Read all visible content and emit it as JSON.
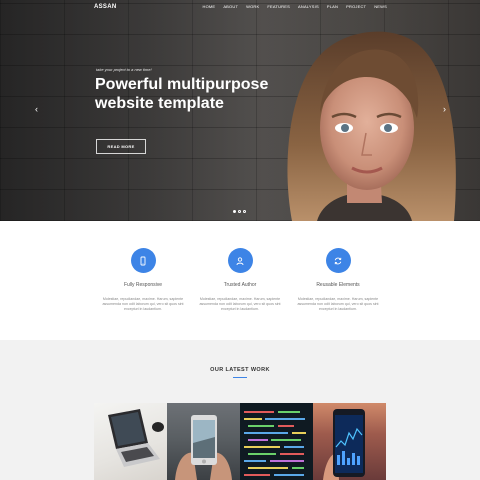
{
  "nav": {
    "logo": "ASSAN",
    "items": [
      "HOME",
      "ABOUT",
      "WORK",
      "FEATURES",
      "ANALYSIS",
      "PLAN",
      "PROJECT",
      "NEWS"
    ]
  },
  "hero": {
    "kicker": "take your project to a new time!",
    "headline": "Powerful multipurpose website template",
    "button": "READ MORE",
    "prev_icon": "chevron-left-icon",
    "next_icon": "chevron-right-icon",
    "slides": 3,
    "active_slide": 1
  },
  "features": [
    {
      "icon": "mobile-phone-icon",
      "title": "Fully Responsive",
      "text": "Molestiae, repudiandae, maxime. Harum, sapiente assumenda non odit laborum qui, vero sit quos sint excepturi in laudantium."
    },
    {
      "icon": "user-icon",
      "title": "Trusted Author",
      "text": "Molestiae, repudiandae, maxime. Harum, sapiente assumenda non odit laborum qui, vero sit quos sint excepturi in laudantium."
    },
    {
      "icon": "refresh-icon",
      "title": "Reusable Elements",
      "text": "Molestiae, repudiandae, maxime. Harum, sapiente assumenda non odit laborum qui, vero sit quos sint excepturi in laudantium."
    }
  ],
  "work": {
    "title": "OUR LATEST WORK",
    "tiles": [
      "laptop-photo",
      "phone-camera-photo",
      "code-screen-photo",
      "phone-chart-photo"
    ]
  },
  "colors": {
    "accent": "#3d84e6",
    "hero_dark": "#3a3939",
    "work_bg": "#f2f2f2"
  }
}
